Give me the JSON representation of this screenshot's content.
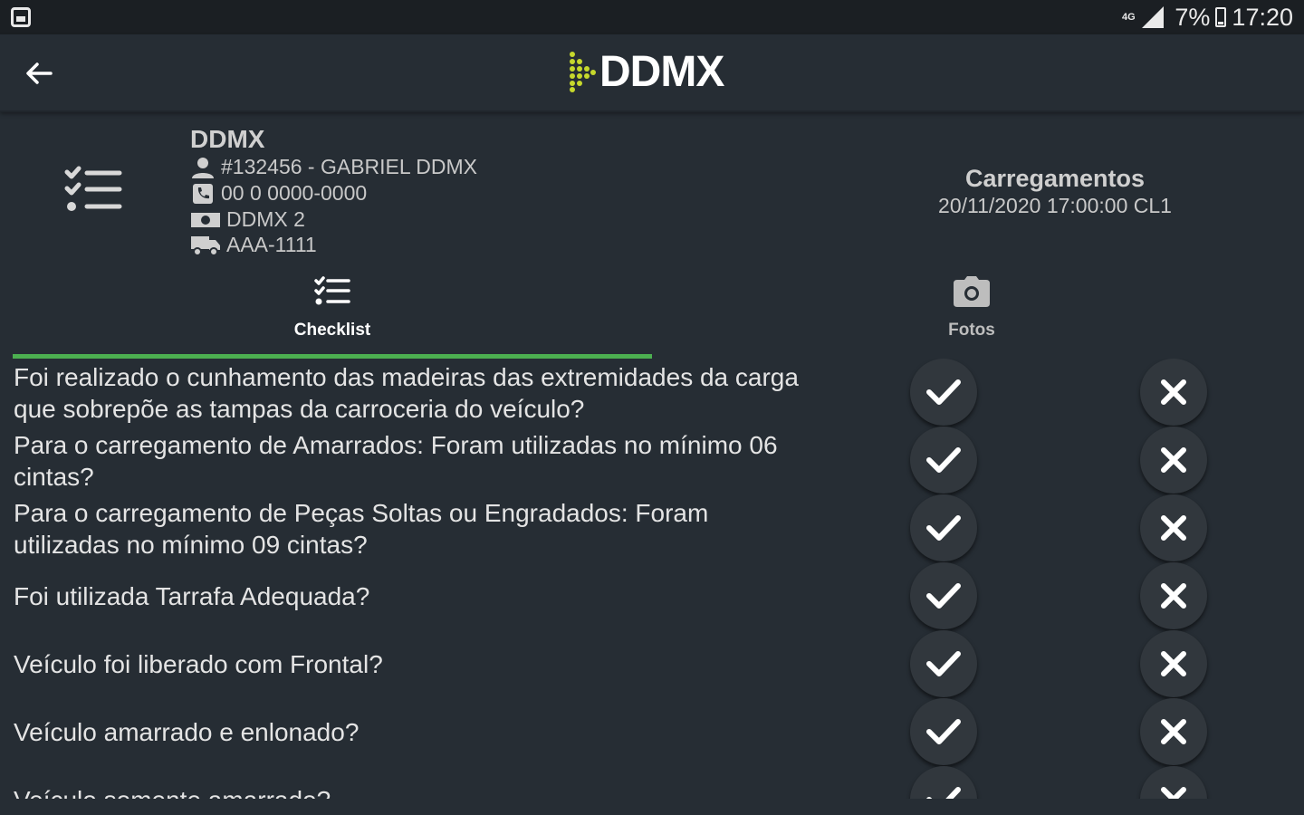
{
  "status_bar": {
    "network": "4G",
    "battery": "7%",
    "time": "17:20"
  },
  "app_bar": {
    "logo_text": "DDMX",
    "logo_color": "#c6d82c"
  },
  "info": {
    "company": "DDMX",
    "driver": "#132456 - GABRIEL DDMX",
    "phone": "00 0 0000-0000",
    "account": "DDMX 2",
    "plate": "AAA-1111",
    "load_title": "Carregamentos",
    "load_datetime": "20/11/2020 17:00:00 CL1"
  },
  "tabs": [
    {
      "label": "Checklist",
      "icon": "checklist-icon",
      "active": true
    },
    {
      "label": "Fotos",
      "icon": "camera-icon",
      "active": false
    }
  ],
  "accent_color": "#4caf50",
  "checklist": [
    {
      "question": "Foi realizado o cunhamento das madeiras das extremidades da carga que sobrepõe as tampas da carroceria do veículo?"
    },
    {
      "question": "Para o carregamento de Amarrados: Foram utilizadas no mínimo 06 cintas?"
    },
    {
      "question": "Para o carregamento de Peças Soltas ou Engradados: Foram utilizadas no mínimo 09 cintas?"
    },
    {
      "question": "Foi utilizada Tarrafa Adequada?"
    },
    {
      "question": "Veículo foi liberado com Frontal?"
    },
    {
      "question": "Veículo amarrado e enlonado?"
    },
    {
      "question": "Veículo somente amarrado?"
    }
  ]
}
